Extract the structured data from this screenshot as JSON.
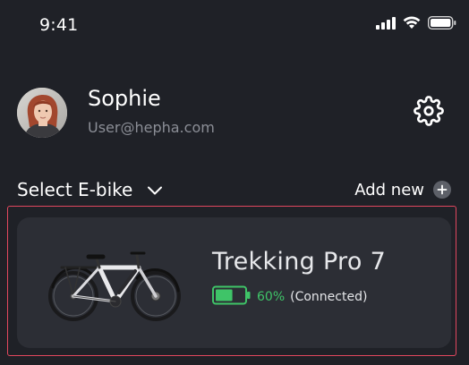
{
  "status_bar": {
    "time": "9:41",
    "icons": [
      "signal-icon",
      "wifi-icon",
      "battery-icon"
    ]
  },
  "profile": {
    "name": "Sophie",
    "email": "User@hepha.com",
    "avatar_icon": "avatar-photo",
    "settings_icon": "gear-icon"
  },
  "select_section": {
    "label": "Select E-bike",
    "dropdown_icon": "chevron-down-icon",
    "add_new_label": "Add new",
    "add_icon": "plus-circle-icon"
  },
  "bike": {
    "model": "Trekking Pro 7",
    "battery_percent": "60%",
    "battery_level": 0.6,
    "status": "(Connected)",
    "accent_color": "#3fc468"
  },
  "colors": {
    "background": "#1f2127",
    "card": "#2c2e35",
    "highlight": "#e0475e",
    "muted_text": "#8b8e96"
  }
}
